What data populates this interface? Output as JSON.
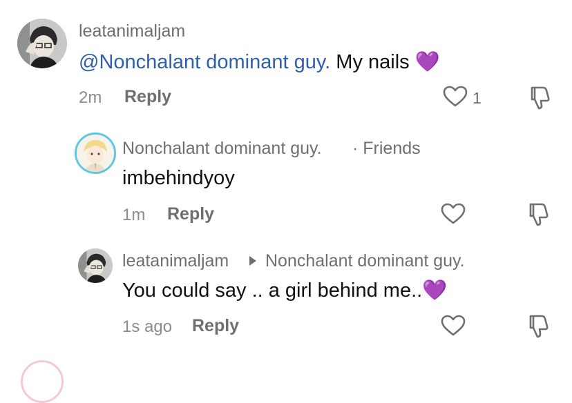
{
  "comments": [
    {
      "username": "leatanimaljam",
      "mention": "@Nonchalant dominant guy.",
      "text": " My nails ",
      "emoji": "💜",
      "time": "2m",
      "reply_label": "Reply",
      "like_count": "1"
    },
    {
      "username": "Nonchalant dominant guy.",
      "friends_tag": "· Friends",
      "text": "imbehindyoy",
      "time": "1m",
      "reply_label": "Reply"
    },
    {
      "username": "leatanimaljam",
      "reply_to": "Nonchalant dominant guy.",
      "text": "You could say .. a girl behind me..",
      "emoji": "💜",
      "time": "1s ago",
      "reply_label": "Reply"
    }
  ],
  "colors": {
    "mention": "#2f5fa8",
    "friend_ring": "#5cc8e0",
    "muted": "#8a8a8f"
  }
}
